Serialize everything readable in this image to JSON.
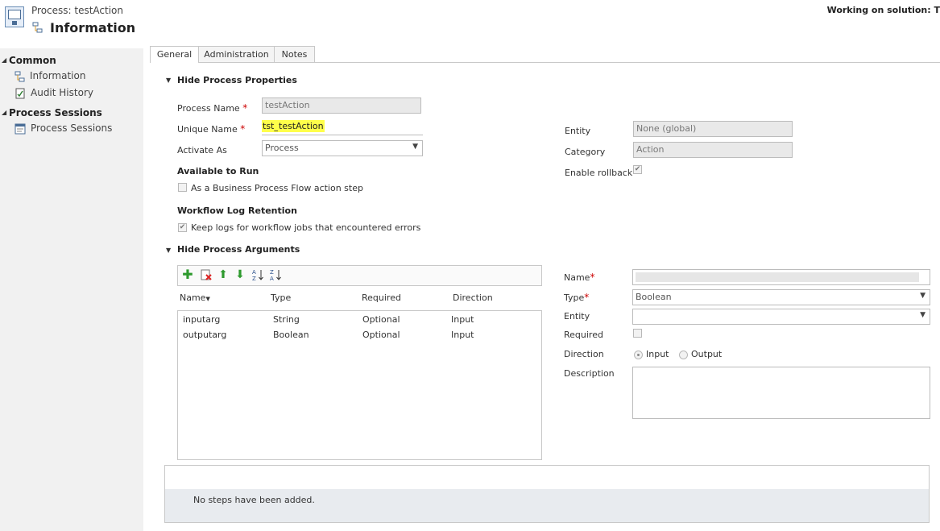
{
  "header": {
    "subtitle": "Process: testAction",
    "title": "Information",
    "solution": "Working on solution: T"
  },
  "leftnav": {
    "groups": [
      {
        "label": "Common",
        "items": [
          {
            "label": "Information"
          },
          {
            "label": "Audit History"
          }
        ]
      },
      {
        "label": "Process Sessions",
        "items": [
          {
            "label": "Process Sessions"
          }
        ]
      }
    ]
  },
  "tabs": [
    {
      "label": "General"
    },
    {
      "label": "Administration"
    },
    {
      "label": "Notes"
    }
  ],
  "properties": {
    "section_title": "Hide Process Properties",
    "process_name_label": "Process Name",
    "process_name_value": "testAction",
    "unique_name_label": "Unique Name",
    "unique_name_prefix": "tst_",
    "unique_name_value": "testAction",
    "activate_as_label": "Activate As",
    "activate_as_value": "Process",
    "available_to_run_title": "Available to Run",
    "bpf_option_label": "As a Business Process Flow action step",
    "bpf_checked": false,
    "log_retention_title": "Workflow Log Retention",
    "log_option_label": "Keep logs for workflow jobs that encountered errors",
    "log_checked": true,
    "entity_label": "Entity",
    "entity_value": "None (global)",
    "category_label": "Category",
    "category_value": "Action",
    "rollback_label": "Enable rollback",
    "rollback_checked": true
  },
  "arguments": {
    "section_title": "Hide Process Arguments",
    "toolbar_icons": [
      "add-icon",
      "delete-icon",
      "move-up-icon",
      "move-down-icon",
      "sort-asc-icon",
      "sort-desc-icon"
    ],
    "columns": [
      "Name",
      "Type",
      "Required",
      "Direction"
    ],
    "rows": [
      [
        "inputarg",
        "String",
        "Optional",
        "Input"
      ],
      [
        "outputarg",
        "Boolean",
        "Optional",
        "Input"
      ]
    ],
    "form": {
      "name_label": "Name",
      "name_value": "",
      "type_label": "Type",
      "type_value": "Boolean",
      "entity_label": "Entity",
      "entity_value": "",
      "required_label": "Required",
      "direction_label": "Direction",
      "direction_input": "Input",
      "direction_output": "Output",
      "direction_selected": "Input",
      "description_label": "Description",
      "description_value": ""
    }
  },
  "steps": {
    "empty_text": "No steps have been added."
  },
  "colors": {
    "highlight": "#ffff4a",
    "required": "#cc0000",
    "icon_green": "#2e9a2e"
  }
}
